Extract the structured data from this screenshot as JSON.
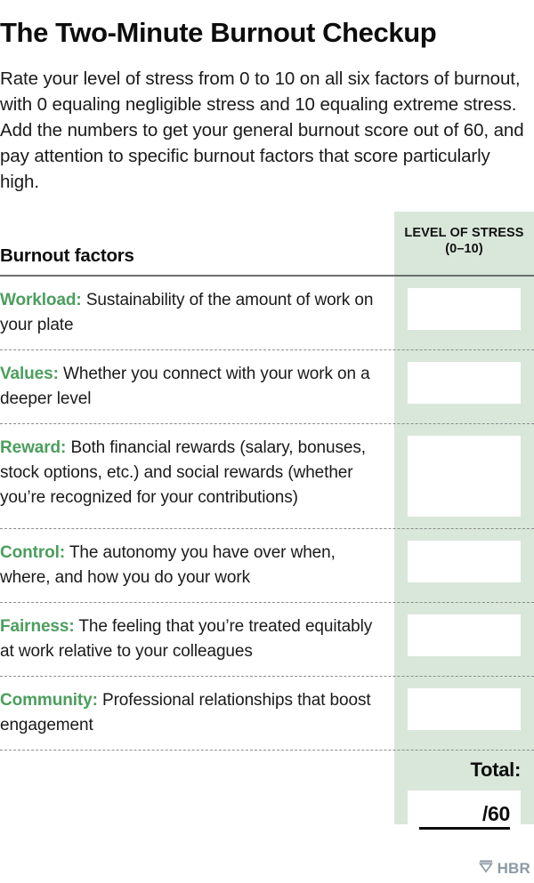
{
  "title": "The Two-Minute Burnout Checkup",
  "intro": "Rate your level of stress from 0 to 10 on all six factors of burnout, with 0 equaling negligible stress and 10 equaling extreme stress. Add the numbers to get your general burnout score out of 60, and pay attention to specific burnout factors that score particularly high.",
  "table": {
    "header": {
      "factors_label": "Burnout factors",
      "score_label_line1": "LEVEL OF STRESS",
      "score_label_line2": "(0–10)"
    },
    "rows": [
      {
        "name": "Workload:",
        "description": " Sustainability of the amount of work on your plate",
        "value": ""
      },
      {
        "name": "Values:",
        "description": " Whether you connect with your work on a deeper level",
        "value": ""
      },
      {
        "name": "Reward:",
        "description": " Both financial rewards (salary, bonuses, stock options, etc.) and social rewards (whether you’re recognized for your contributions)",
        "value": ""
      },
      {
        "name": "Control:",
        "description": " The autonomy you have over when, where, and how you do your work",
        "value": ""
      },
      {
        "name": "Fairness:",
        "description": " The feeling that you’re treated equitably at work relative to your colleagues",
        "value": ""
      },
      {
        "name": "Community:",
        "description": " Professional relationships that boost engagement",
        "value": ""
      }
    ],
    "total": {
      "label": "Total:",
      "value": "",
      "suffix": "/60"
    }
  },
  "footer": {
    "logo_text": "HBR",
    "logo_mark": "shield-icon"
  },
  "colors": {
    "accent_green": "#4b9e5d",
    "panel_green": "#d8e7da",
    "logo_grey": "#8e9aa4",
    "rule_dark": "#6e6e6e"
  }
}
